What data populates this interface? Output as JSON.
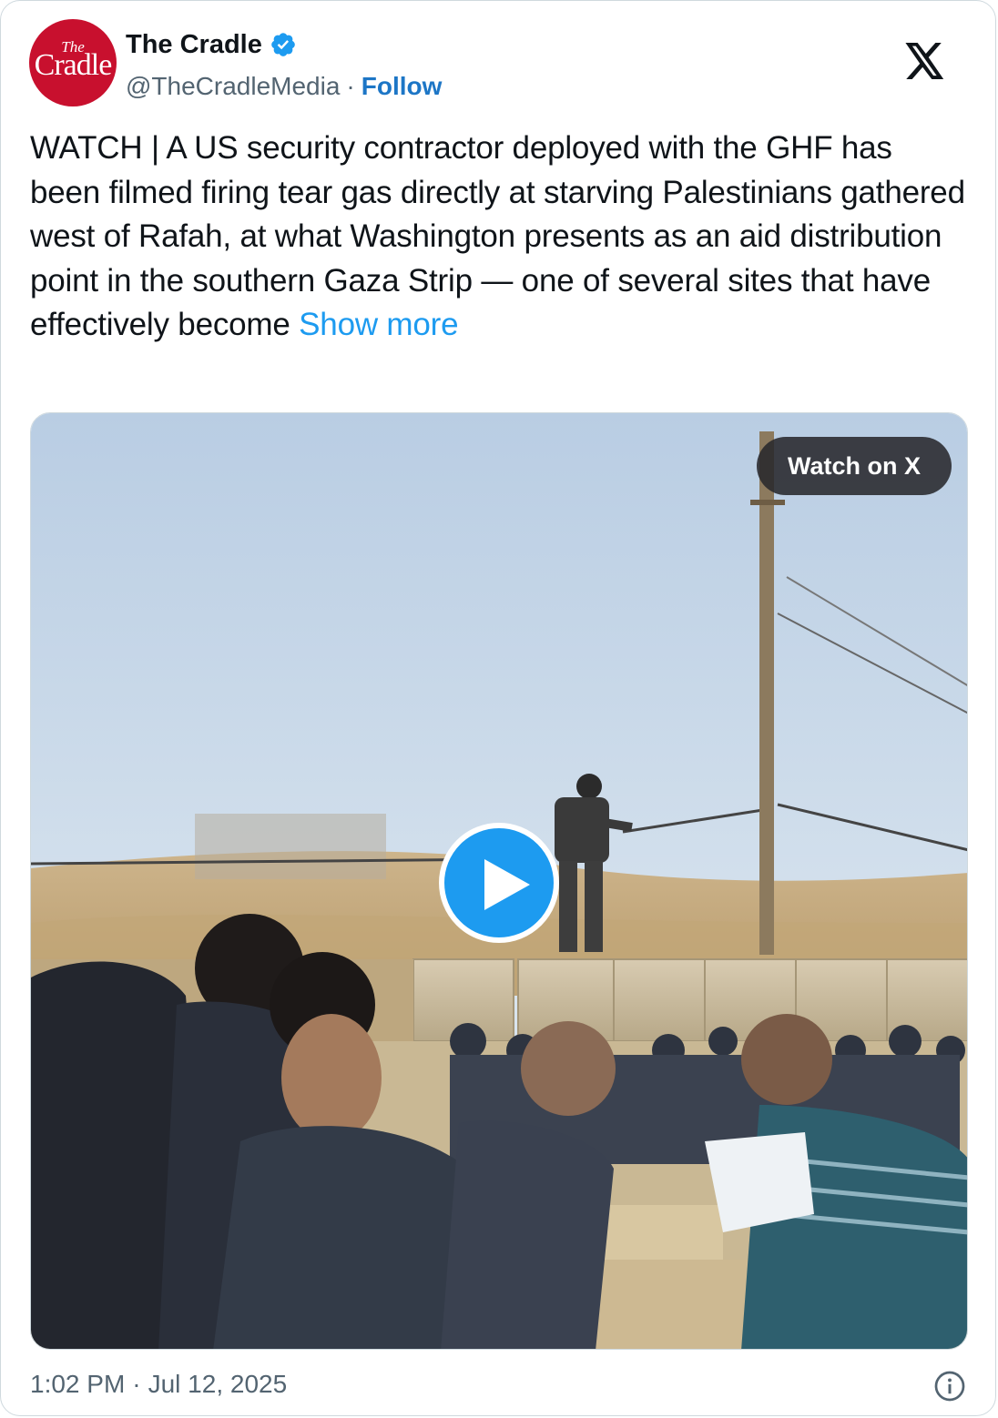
{
  "author": {
    "display_name": "The Cradle",
    "handle": "@TheCradleMedia",
    "follow_label": "Follow",
    "avatar_small_text": "The",
    "avatar_big_text": "Cradle",
    "avatar_color": "#c8102e",
    "verified_icon": "verified-badge-icon"
  },
  "tweet": {
    "text": "WATCH | A US security contractor deployed with the GHF has been filmed firing tear gas directly at starving Palestinians gathered west of Rafah, at what Washington presents as an aid distribution point in the southern Gaza Strip — one of several sites that have effectively become",
    "show_more_label": "Show more"
  },
  "media": {
    "watch_label": "Watch on X",
    "play_icon": "play-icon",
    "thumbnail_subject": "video-thumbnail"
  },
  "footer": {
    "time": "1:02 PM",
    "date": "Jul 12, 2025",
    "info_icon": "info-icon"
  },
  "colors": {
    "link": "#1d9bf0",
    "follow": "#1d76c6",
    "secondary_text": "#536471",
    "border": "#cfd9de"
  }
}
